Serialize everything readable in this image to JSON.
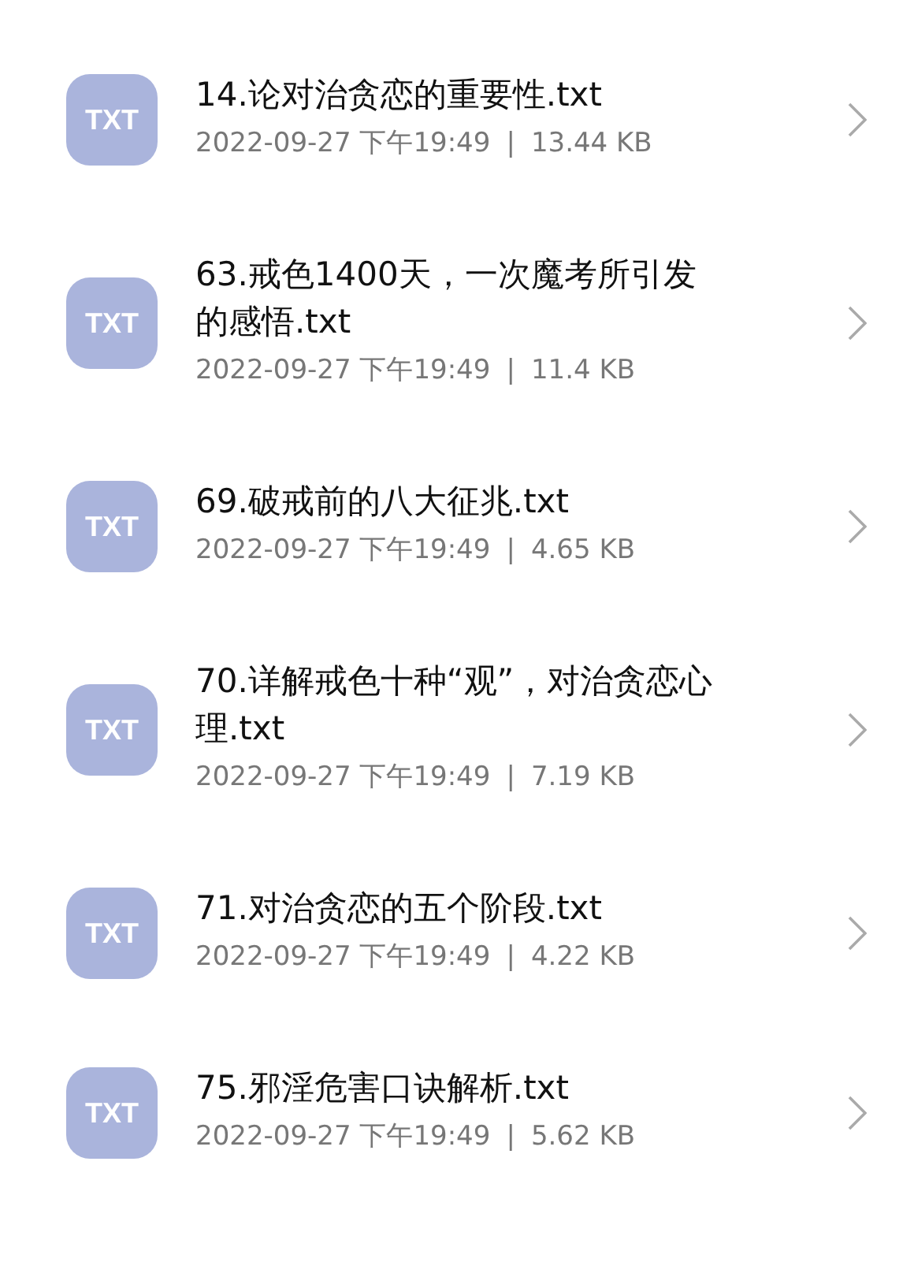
{
  "files": [
    {
      "icon": "TXT",
      "name": "14.论对治贪恋的重要性.txt",
      "date": "2022-09-27 下午19:49",
      "separator": "|",
      "size": "13.44 KB"
    },
    {
      "icon": "TXT",
      "name": "63.戒色1400天，一次魔考所引发的感悟.txt",
      "date": "2022-09-27 下午19:49",
      "separator": "|",
      "size": "11.4 KB"
    },
    {
      "icon": "TXT",
      "name": "69.破戒前的八大征兆.txt",
      "date": "2022-09-27 下午19:49",
      "separator": "|",
      "size": "4.65 KB"
    },
    {
      "icon": "TXT",
      "name": "70.详解戒色十种“观”，对治贪恋心理.txt",
      "date": "2022-09-27 下午19:49",
      "separator": "|",
      "size": "7.19 KB"
    },
    {
      "icon": "TXT",
      "name": "71.对治贪恋的五个阶段.txt",
      "date": "2022-09-27 下午19:49",
      "separator": "|",
      "size": "4.22 KB"
    },
    {
      "icon": "TXT",
      "name": "75.邪淫危害口诀解析.txt",
      "date": "2022-09-27 下午19:49",
      "separator": "|",
      "size": "5.62 KB"
    }
  ]
}
